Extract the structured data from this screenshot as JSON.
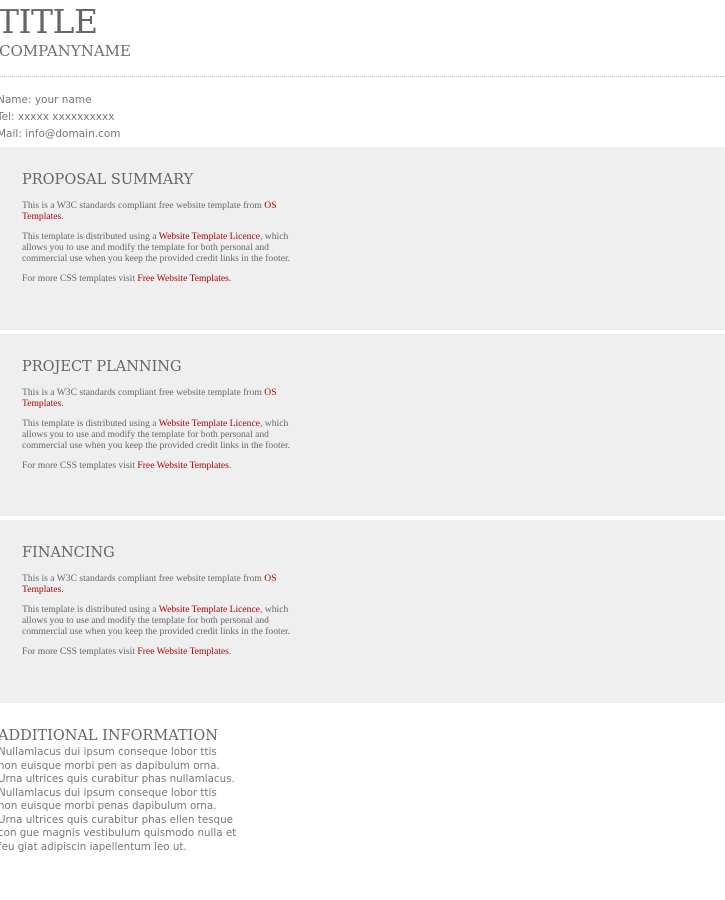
{
  "header": {
    "title": "TITLE",
    "company": "COMPANYNAME"
  },
  "contact": {
    "name": "Name: your name",
    "tel": "Tel: xxxxx xxxxxxxxxx",
    "mail": "Mail: info@domain.com"
  },
  "sections": [
    {
      "title": "PROPOSAL SUMMARY",
      "p1_text": "This is a W3C standards compliant free website template from ",
      "p1_link": "OS Templates",
      "p1_end": ".",
      "p2_text": "This template is distributed using a ",
      "p2_link": "Website Template Licence",
      "p2_end": ", which allows you to use and modify the template for both personal and commercial use when you keep the provided credit links in the footer.",
      "p3_text": "For more CSS templates visit ",
      "p3_link": "Free Website Templates",
      "p3_end": "."
    },
    {
      "title": "PROJECT PLANNING",
      "p1_text": "This is a W3C standards compliant free website template from ",
      "p1_link": "OS Templates",
      "p1_end": ".",
      "p2_text": "This template is distributed using a ",
      "p2_link": "Website Template Licence",
      "p2_end": ", which allows you to use and modify the template for both personal and commercial use when you keep the provided credit links in the footer.",
      "p3_text": "For more CSS templates visit ",
      "p3_link": "Free Website Templates",
      "p3_end": "."
    },
    {
      "title": "FINANCING",
      "p1_text": "This is a W3C standards compliant free website template from ",
      "p1_link": "OS Templates",
      "p1_end": ".",
      "p2_text": "This template is distributed using a ",
      "p2_link": "Website Template Licence",
      "p2_end": ", which allows you to use and modify the template for both personal and commercial use when you keep the provided credit links in the footer.",
      "p3_text": "For more CSS templates visit ",
      "p3_link": "Free Website Templates",
      "p3_end": "."
    }
  ],
  "additional": {
    "title": "ADDITIONAL INFORMATION",
    "body": "Nullamlacus dui ipsum conseque lobor ttis non euisque morbi pen as dapibulum orna. Urna ultrices quis curabitur phas nullamlacus. Nullamlacus dui ipsum conseque lobor ttis non euisque morbi penas dapibulum orna. Urna ultrices quis curabitur phas ellen tesque con gue magnis vestibulum quismodo nulla et feu giat adipiscin iapellentum leo ut."
  },
  "colors": {
    "link": "#b00000",
    "panel_bg": "#efefef",
    "text": "#666666"
  }
}
